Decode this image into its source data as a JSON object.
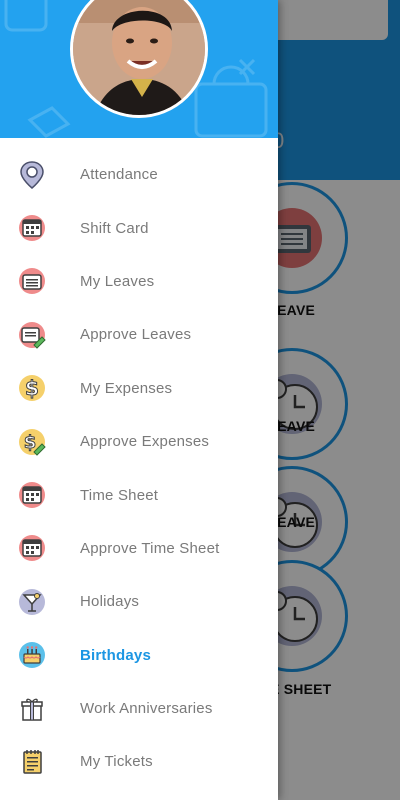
{
  "background": {
    "header_text": "0",
    "cards": [
      {
        "label": "PLY LEAVE",
        "icon": "briefcase-icon"
      },
      {
        "label": "PLY LEAVE",
        "icon": "clock-icon"
      },
      {
        "label": "PLY LEAVE",
        "icon": "clock-icon"
      },
      {
        "label": "IE SHEET",
        "icon": "clock-icon"
      }
    ]
  },
  "drawer": {
    "avatar_icon": "user-avatar",
    "menu": [
      {
        "label": "Attendance",
        "icon": "location-pin-icon"
      },
      {
        "label": "Shift Card",
        "icon": "calendar-icon"
      },
      {
        "label": "My Leaves",
        "icon": "briefcase-icon"
      },
      {
        "label": "Approve Leaves",
        "icon": "briefcase-approve-icon"
      },
      {
        "label": "My Expenses",
        "icon": "dollar-icon"
      },
      {
        "label": "Approve Expenses",
        "icon": "dollar-approve-icon"
      },
      {
        "label": "Time Sheet",
        "icon": "calendar-icon"
      },
      {
        "label": "Approve Time Sheet",
        "icon": "calendar-icon"
      },
      {
        "label": "Holidays",
        "icon": "cocktail-icon"
      },
      {
        "label": "Birthdays",
        "icon": "cake-icon",
        "active": true
      },
      {
        "label": "Work Anniversaries",
        "icon": "gift-icon"
      },
      {
        "label": "My Tickets",
        "icon": "notepad-icon"
      }
    ]
  },
  "colors": {
    "primary": "#23a2ef",
    "active_text": "#1c96e3",
    "menu_text": "#7a7a7a"
  }
}
